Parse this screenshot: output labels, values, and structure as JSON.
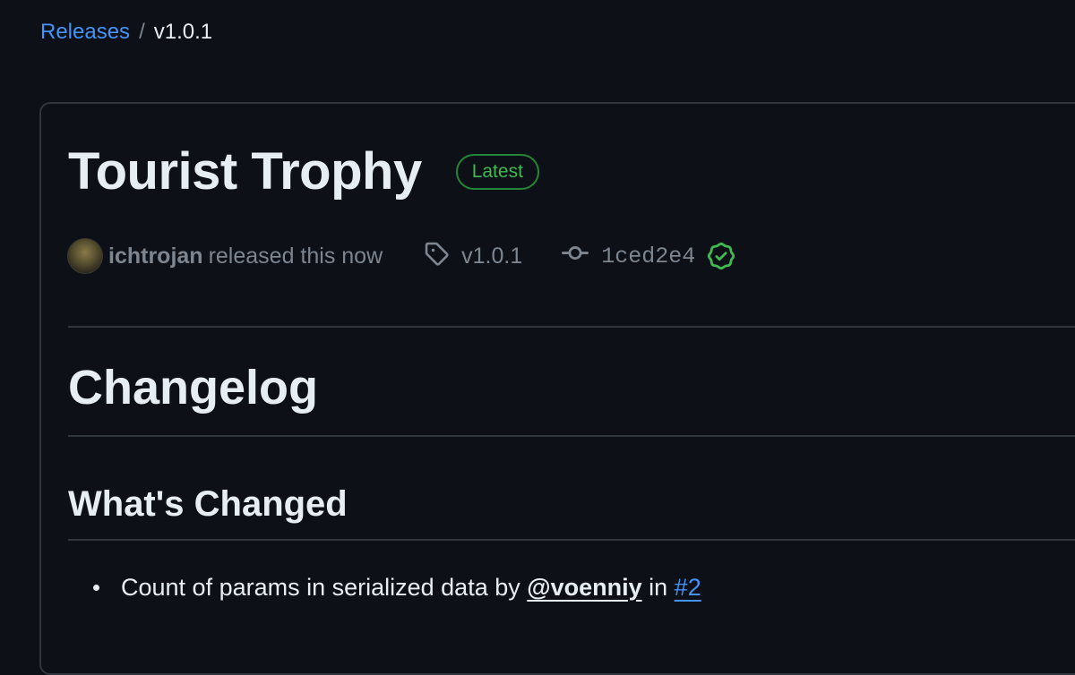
{
  "breadcrumb": {
    "parent": "Releases",
    "separator": "/",
    "current": "v1.0.1"
  },
  "release": {
    "title": "Tourist Trophy",
    "badge": "Latest",
    "author": "ichtrojan",
    "released_text": "released this now",
    "tag": "v1.0.1",
    "commit": "1ced2e4",
    "commit_verified": true
  },
  "body": {
    "heading": "Changelog",
    "subheading": "What's Changed",
    "changes": [
      {
        "text": "Count of params in serialized data by",
        "mention": "@voenniy",
        "in_word": "in",
        "pr": "#2"
      }
    ]
  },
  "colors": {
    "background": "#0d1117",
    "link": "#4493f8",
    "badge_green": "#3fb950",
    "muted": "#7d8590",
    "border": "#30363d"
  },
  "icons": {
    "tag": "tag-icon",
    "commit": "git-commit-icon",
    "verified": "verified-check-icon"
  }
}
